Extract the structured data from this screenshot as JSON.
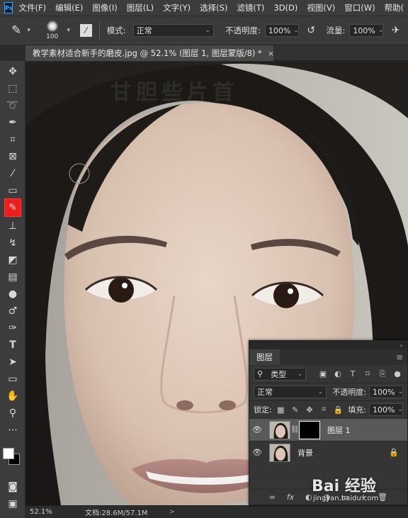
{
  "app": {
    "logo": "Ps"
  },
  "menu": [
    "文件(F)",
    "编辑(E)",
    "图像(I)",
    "图层(L)",
    "文字(Y)",
    "选择(S)",
    "滤镜(T)",
    "3D(D)",
    "视图(V)",
    "窗口(W)",
    "帮助("
  ],
  "options": {
    "brush_size": "100",
    "mode_label": "模式:",
    "mode_value": "正常",
    "opacity_label": "不透明度:",
    "opacity_value": "100%",
    "flow_label": "流量:",
    "flow_value": "100%"
  },
  "document_tab": {
    "title": "教学素材适合新手的磨皮.jpg @ 52.1% (图层 1, 图层蒙版/8) *",
    "close": "×"
  },
  "tools": [
    "move-icon",
    "marquee-icon",
    "lasso-icon",
    "quick-select-icon",
    "crop-icon",
    "frame-icon",
    "eyedropper-icon",
    "healing-icon",
    "brush-icon",
    "stamp-icon",
    "history-brush-icon",
    "eraser-icon",
    "gradient-icon",
    "blur-icon",
    "dodge-icon",
    "pen-icon",
    "type-icon",
    "path-select-icon",
    "rectangle-icon",
    "hand-icon",
    "zoom-icon",
    "more-icon"
  ],
  "canvas": {
    "overlay_text": "甘胆些片首"
  },
  "status": {
    "zoom": "52.1%",
    "doc_info": "文档:28.6M/57.1M",
    "arrow": ">"
  },
  "layers_panel": {
    "tab": "图层",
    "filter_label": "类型",
    "blend_mode": "正常",
    "opacity_label": "不透明度:",
    "opacity_value": "100%",
    "lock_label": "锁定:",
    "fill_label": "填充:",
    "fill_value": "100%",
    "layers": [
      {
        "name": "图层 1",
        "selected": true,
        "has_mask": true
      },
      {
        "name": "背景",
        "selected": false,
        "has_mask": false
      }
    ],
    "bottom": [
      "∞",
      "fx",
      "◐",
      "◑",
      "▭",
      "+",
      "🗑"
    ]
  },
  "watermark": {
    "main": "Bai 经验",
    "sub": "jingyan.baidu.com"
  },
  "colors": {
    "active_tool_highlight": "#ee1c1c",
    "panel_bg": "#353535",
    "menubar_bg": "#3c3c3c"
  }
}
